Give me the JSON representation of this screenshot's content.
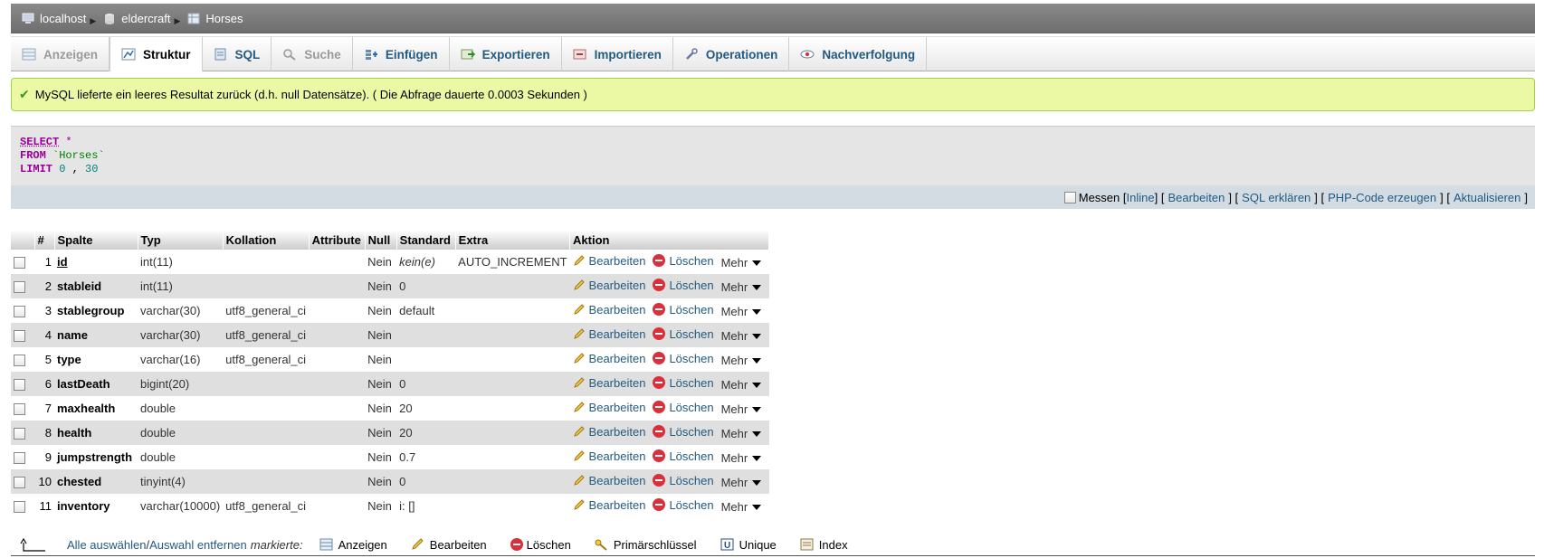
{
  "breadcrumb": [
    {
      "label": "localhost",
      "icon": "server-icon"
    },
    {
      "label": "eldercraft",
      "icon": "database-icon"
    },
    {
      "label": "Horses",
      "icon": "table-icon"
    }
  ],
  "tabs": [
    {
      "label": "Anzeigen",
      "icon": "browse-icon",
      "state": "disabled"
    },
    {
      "label": "Struktur",
      "icon": "structure-icon",
      "state": "active"
    },
    {
      "label": "SQL",
      "icon": "sql-icon",
      "state": "normal"
    },
    {
      "label": "Suche",
      "icon": "search-icon",
      "state": "disabled"
    },
    {
      "label": "Einfügen",
      "icon": "insert-icon",
      "state": "normal"
    },
    {
      "label": "Exportieren",
      "icon": "export-icon",
      "state": "normal"
    },
    {
      "label": "Importieren",
      "icon": "import-icon",
      "state": "normal"
    },
    {
      "label": "Operationen",
      "icon": "wrench-icon",
      "state": "normal"
    },
    {
      "label": "Nachverfolgung",
      "icon": "eye-icon",
      "state": "normal"
    }
  ],
  "success_message": "MySQL lieferte ein leeres Resultat zurück (d.h. null Datensätze). ( Die Abfrage dauerte 0.0003 Sekunden )",
  "sql": {
    "select": "SELECT",
    "star": " *",
    "from": "FROM",
    "table": " `Horses`",
    "limit": "LIMIT",
    "limit_a": " 0",
    "limit_sep": " , ",
    "limit_b": "30"
  },
  "sql_actions": {
    "messen": "Messen",
    "inline": "Inline",
    "bearbeiten": "Bearbeiten",
    "erklaeren": "SQL erklären",
    "php": "PHP-Code erzeugen",
    "aktualisieren": "Aktualisieren"
  },
  "table": {
    "headers": [
      "#",
      "Spalte",
      "Typ",
      "Kollation",
      "Attribute",
      "Null",
      "Standard",
      "Extra",
      "Aktion"
    ],
    "action_labels": {
      "edit": "Bearbeiten",
      "delete": "Löschen",
      "more": "Mehr"
    },
    "rows": [
      {
        "num": "1",
        "name": "id",
        "type": "int(11)",
        "collation": "",
        "attributes": "",
        "null": "Nein",
        "default": "kein(e)",
        "extra": "AUTO_INCREMENT"
      },
      {
        "num": "2",
        "name": "stableid",
        "type": "int(11)",
        "collation": "",
        "attributes": "",
        "null": "Nein",
        "default": "0",
        "extra": ""
      },
      {
        "num": "3",
        "name": "stablegroup",
        "type": "varchar(30)",
        "collation": "utf8_general_ci",
        "attributes": "",
        "null": "Nein",
        "default": "default",
        "extra": ""
      },
      {
        "num": "4",
        "name": "name",
        "type": "varchar(30)",
        "collation": "utf8_general_ci",
        "attributes": "",
        "null": "Nein",
        "default": "",
        "extra": ""
      },
      {
        "num": "5",
        "name": "type",
        "type": "varchar(16)",
        "collation": "utf8_general_ci",
        "attributes": "",
        "null": "Nein",
        "default": "",
        "extra": ""
      },
      {
        "num": "6",
        "name": "lastDeath",
        "type": "bigint(20)",
        "collation": "",
        "attributes": "",
        "null": "Nein",
        "default": "0",
        "extra": ""
      },
      {
        "num": "7",
        "name": "maxhealth",
        "type": "double",
        "collation": "",
        "attributes": "",
        "null": "Nein",
        "default": "20",
        "extra": ""
      },
      {
        "num": "8",
        "name": "health",
        "type": "double",
        "collation": "",
        "attributes": "",
        "null": "Nein",
        "default": "20",
        "extra": ""
      },
      {
        "num": "9",
        "name": "jumpstrength",
        "type": "double",
        "collation": "",
        "attributes": "",
        "null": "Nein",
        "default": "0.7",
        "extra": ""
      },
      {
        "num": "10",
        "name": "chested",
        "type": "tinyint(4)",
        "collation": "",
        "attributes": "",
        "null": "Nein",
        "default": "0",
        "extra": ""
      },
      {
        "num": "11",
        "name": "inventory",
        "type": "varchar(10000)",
        "collation": "utf8_general_ci",
        "attributes": "",
        "null": "Nein",
        "default": "i: []",
        "extra": ""
      }
    ]
  },
  "bottom": {
    "select_all": "Alle auswählen",
    "sep": " / ",
    "deselect_all": "Auswahl entfernen",
    "marked": "markierte:",
    "actions": [
      {
        "label": "Anzeigen",
        "icon": "browse-icon"
      },
      {
        "label": "Bearbeiten",
        "icon": "pencil-icon"
      },
      {
        "label": "Löschen",
        "icon": "delete-icon"
      },
      {
        "label": "Primärschlüssel",
        "icon": "key-icon"
      },
      {
        "label": "Unique",
        "icon": "unique-icon"
      },
      {
        "label": "Index",
        "icon": "index-icon"
      }
    ]
  }
}
